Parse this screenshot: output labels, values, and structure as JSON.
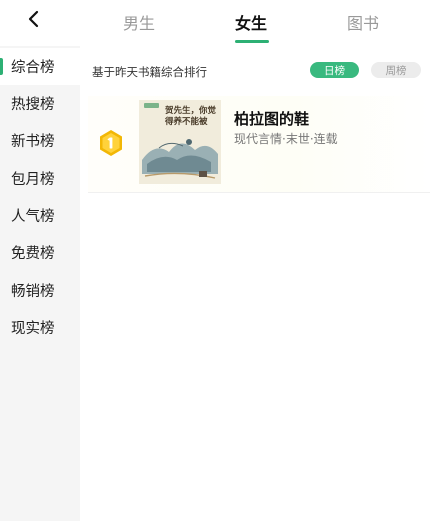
{
  "header": {
    "tabs": [
      {
        "label": "男生",
        "active": false
      },
      {
        "label": "女生",
        "active": true
      },
      {
        "label": "图书",
        "active": false
      }
    ]
  },
  "sidebar": {
    "items": [
      {
        "label": "综合榜",
        "active": true
      },
      {
        "label": "热搜榜",
        "active": false
      },
      {
        "label": "新书榜",
        "active": false
      },
      {
        "label": "包月榜",
        "active": false
      },
      {
        "label": "人气榜",
        "active": false
      },
      {
        "label": "免费榜",
        "active": false
      },
      {
        "label": "畅销榜",
        "active": false
      },
      {
        "label": "现实榜",
        "active": false
      }
    ]
  },
  "main": {
    "subtitle": "基于昨天书籍综合排行",
    "period_toggle": {
      "daily": "日榜",
      "weekly": "周榜",
      "selected": "daily"
    }
  },
  "books": [
    {
      "rank": 1,
      "title": "柏拉图的鞋",
      "tags": "现代言情·末世·连载",
      "cover_text": "贺先生，你觉得养不能被",
      "badge_color": "#f2b705"
    }
  ],
  "colors": {
    "accent": "#2db074",
    "sidebar_bg": "#f5f5f5"
  }
}
